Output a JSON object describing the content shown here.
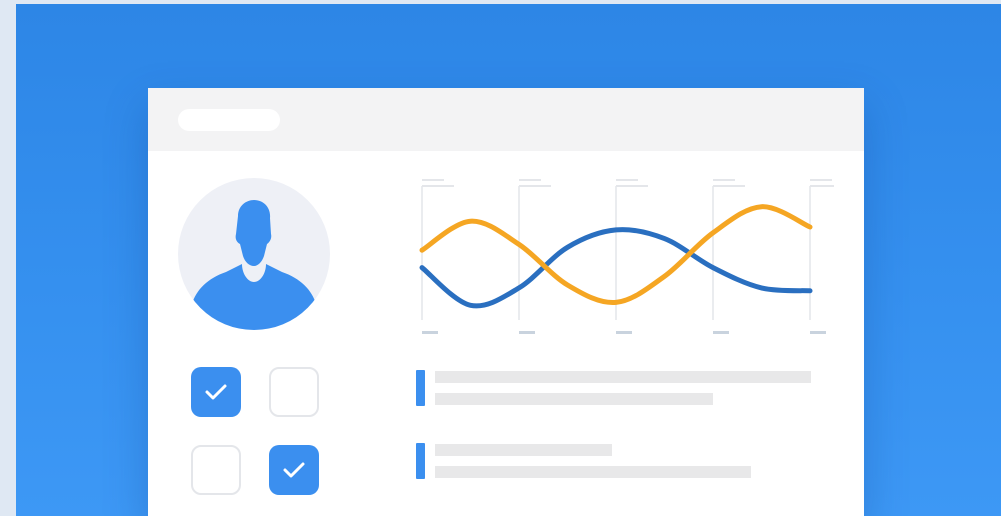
{
  "colors": {
    "background": "#2f88e8",
    "window": "#ffffff",
    "titlebar": "#f3f3f4",
    "accent": "#3b8fef",
    "avatar_bg": "#eef0f6",
    "series_blue": "#2a6fc0",
    "series_orange": "#f5a623",
    "placeholder_line": "#e8e8e9",
    "grid": "#e4e6ea",
    "tick_mark": "#c9d3de"
  },
  "icons": {
    "avatar": "user-silhouette-icon",
    "check": "checkmark-icon"
  },
  "profile": {
    "icon": "user-silhouette-icon"
  },
  "checkboxes": [
    {
      "checked": true
    },
    {
      "checked": false
    },
    {
      "checked": false
    },
    {
      "checked": true
    }
  ],
  "chart_data": {
    "type": "line",
    "title": "",
    "xlabel": "",
    "ylabel": "",
    "grid": true,
    "legend": "none",
    "categories": [
      "",
      "",
      "",
      "",
      ""
    ],
    "xlim": [
      0,
      4
    ],
    "ylim": [
      -1,
      1
    ],
    "series": [
      {
        "color": "#2a6fc0",
        "x": [
          0,
          0.5,
          1,
          1.5,
          2,
          2.5,
          3,
          3.5,
          4
        ],
        "values": [
          -0.2,
          -0.85,
          -0.55,
          0.15,
          0.45,
          0.3,
          -0.2,
          -0.55,
          -0.6
        ]
      },
      {
        "color": "#f5a623",
        "x": [
          0,
          0.5,
          1,
          1.5,
          2,
          2.5,
          3,
          3.5,
          4
        ],
        "values": [
          0.1,
          0.6,
          0.2,
          -0.5,
          -0.8,
          -0.35,
          0.4,
          0.85,
          0.5
        ]
      }
    ]
  },
  "list_items": [
    {
      "lines": [
        1.0,
        0.74
      ]
    },
    {
      "lines": [
        0.47,
        0.84
      ]
    }
  ]
}
